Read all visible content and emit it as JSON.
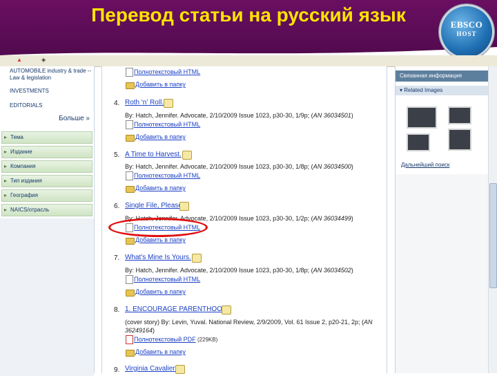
{
  "slide": {
    "title": "Перевод статьи на русский язык",
    "logo_top": "EBSCO",
    "logo_bottom": "HOST"
  },
  "left_panel": {
    "items": [
      "AUTOMOBILE industry & trade --",
      "Law & legislation",
      "INVESTMENTS",
      "EDITORIALS"
    ],
    "more_label": "Больше »",
    "categories": [
      "Тема",
      "Издание",
      "Компания",
      "Тип издания",
      "География",
      "NAICS/отрасль"
    ]
  },
  "results": [
    {
      "number": "",
      "title": "",
      "by": "",
      "an": "",
      "links": [
        "Полнотекстовый HTML",
        "Добавить в папку"
      ]
    },
    {
      "number": "4.",
      "title": "Roth 'n' Roll.",
      "by": "By: Hatch, Jennifer. Advocate, 2/10/2009 Issue 1023, p30-30, 1/9p; (",
      "an": "AN 36034501",
      "links": [
        "Полнотекстовый HTML",
        "Добавить в папку"
      ]
    },
    {
      "number": "5.",
      "title": "A Time to Harvest.",
      "by": "By: Hatch, Jennifer. Advocate, 2/10/2009 Issue 1023, p30-30, 1/8p; (",
      "an": "AN 36034500",
      "links": [
        "Полнотекстовый HTML",
        "Добавить в папку"
      ]
    },
    {
      "number": "6.",
      "title": "Single File, Please.",
      "by": "By: Hatch, Jennifer. Advocate, 2/10/2009 Issue 1023, p30-30, 1/2p; (",
      "an": "AN 36034499",
      "links": [
        "Полнотекстовый HTML",
        "Добавить в папку"
      ]
    },
    {
      "number": "7.",
      "title": "What's Mine Is Yours.",
      "by": "By: Hatch, Jennifer. Advocate, 2/10/2009 Issue 1023, p30-30, 1/8p; (",
      "an": "AN 36034502",
      "links": [
        "Полнотекстовый HTML",
        "Добавить в папку"
      ]
    },
    {
      "number": "8.",
      "title": "1. ENCOURAGE PARENTHOOD.",
      "by": "(cover story) By: Levin, Yuval. National Review, 2/9/2009, Vol. 61 Issue 2, p20-21, 2p; (",
      "by_line2": "36249164",
      "an": "AN",
      "links": [
        "Полнотекстовый PDF",
        "Добавить в папку"
      ],
      "size": "(229KB)"
    },
    {
      "number": "9.",
      "title": "Virginia Cavalier.",
      "by": "",
      "an": "",
      "links": []
    }
  ],
  "right_panel": {
    "heading": "Связанная информация",
    "subheading": "Related Images",
    "more_search": "Дальнейший поиск"
  },
  "colors": {
    "banner": "#5a0c55",
    "title": "#ffe300",
    "highlight": "#e01010",
    "link": "#1a3fc4"
  }
}
